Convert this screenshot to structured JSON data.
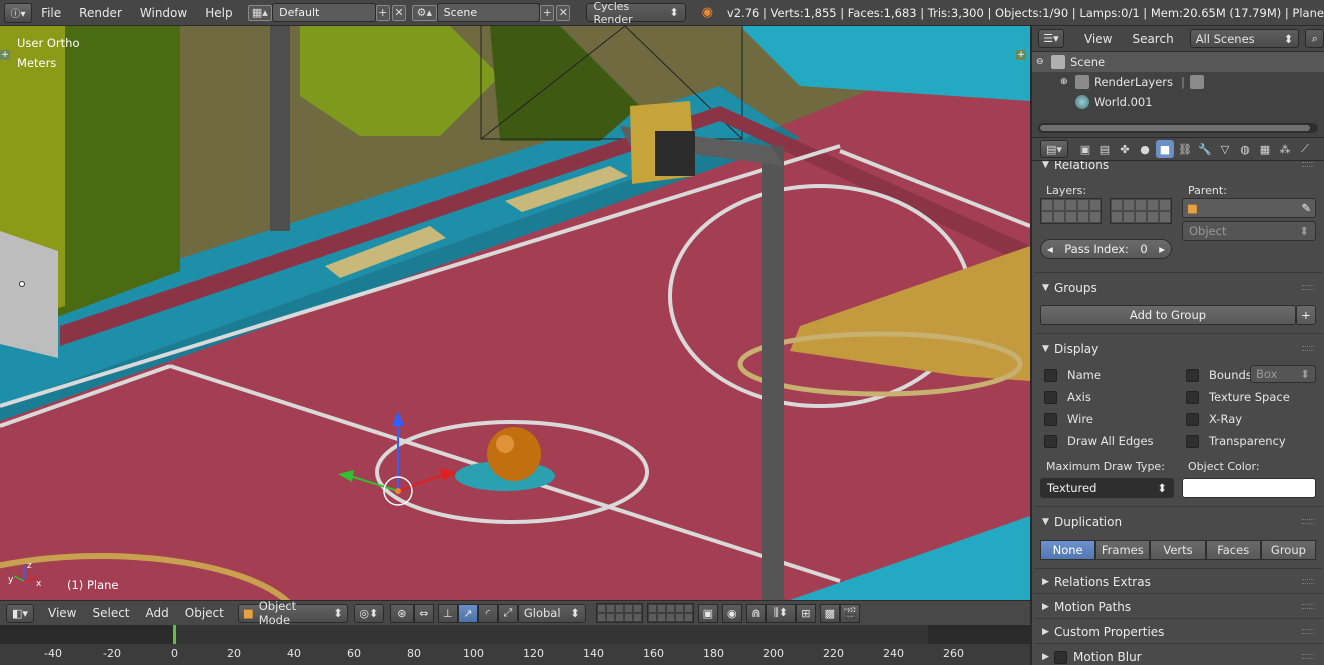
{
  "topbar": {
    "menus": [
      "File",
      "Render",
      "Window",
      "Help"
    ],
    "screen_layout": "Default",
    "scene": "Scene",
    "render_engine": "Cycles Render",
    "stats": "v2.76 | Verts:1,855 | Faces:1,683 | Tris:3,300 | Objects:1/90 | Lamps:0/1 | Mem:20.65M (17.79M) | Plane"
  },
  "viewport": {
    "view_name": "User Ortho",
    "units": "Meters",
    "object_label": "(1) Plane",
    "axis_x": "x",
    "axis_y": "y",
    "axis_z": "z"
  },
  "vp_header": {
    "menus": [
      "View",
      "Select",
      "Add",
      "Object"
    ],
    "mode": "Object Mode",
    "orientation": "Global"
  },
  "timeline": {
    "ticks": [
      "-40",
      "-20",
      "0",
      "20",
      "40",
      "60",
      "80",
      "100",
      "120",
      "140",
      "160",
      "180",
      "200",
      "220",
      "240",
      "260"
    ],
    "current_frame": 1
  },
  "outliner": {
    "menus": [
      "View",
      "Search"
    ],
    "display_mode": "All Scenes",
    "rows": [
      "Scene",
      "RenderLayers",
      "World.001"
    ]
  },
  "properties": {
    "relations": {
      "title": "Relations",
      "layers_label": "Layers:",
      "parent_label": "Parent:",
      "parent_type": "Object",
      "pass_index_label": "Pass Index:",
      "pass_index_value": "0"
    },
    "groups": {
      "title": "Groups",
      "add_button": "Add to Group"
    },
    "display": {
      "title": "Display",
      "left_checks": [
        "Name",
        "Axis",
        "Wire",
        "Draw All Edges"
      ],
      "right_checks": [
        "Bounds",
        "Texture Space",
        "X-Ray",
        "Transparency"
      ],
      "bounds_type": "Box",
      "max_draw_type_label": "Maximum Draw Type:",
      "max_draw_type": "Textured",
      "object_color_label": "Object Color:",
      "object_color": "#ffffff"
    },
    "duplication": {
      "title": "Duplication",
      "options": [
        "None",
        "Frames",
        "Verts",
        "Faces",
        "Group"
      ],
      "selected": "None"
    },
    "collapsed_panels": [
      "Relations Extras",
      "Motion Paths",
      "Custom Properties",
      "Motion Blur"
    ]
  },
  "colors": {
    "accent": "#6b8fc7",
    "court": "#a43e52",
    "timeline_cursor": "#60c040"
  }
}
